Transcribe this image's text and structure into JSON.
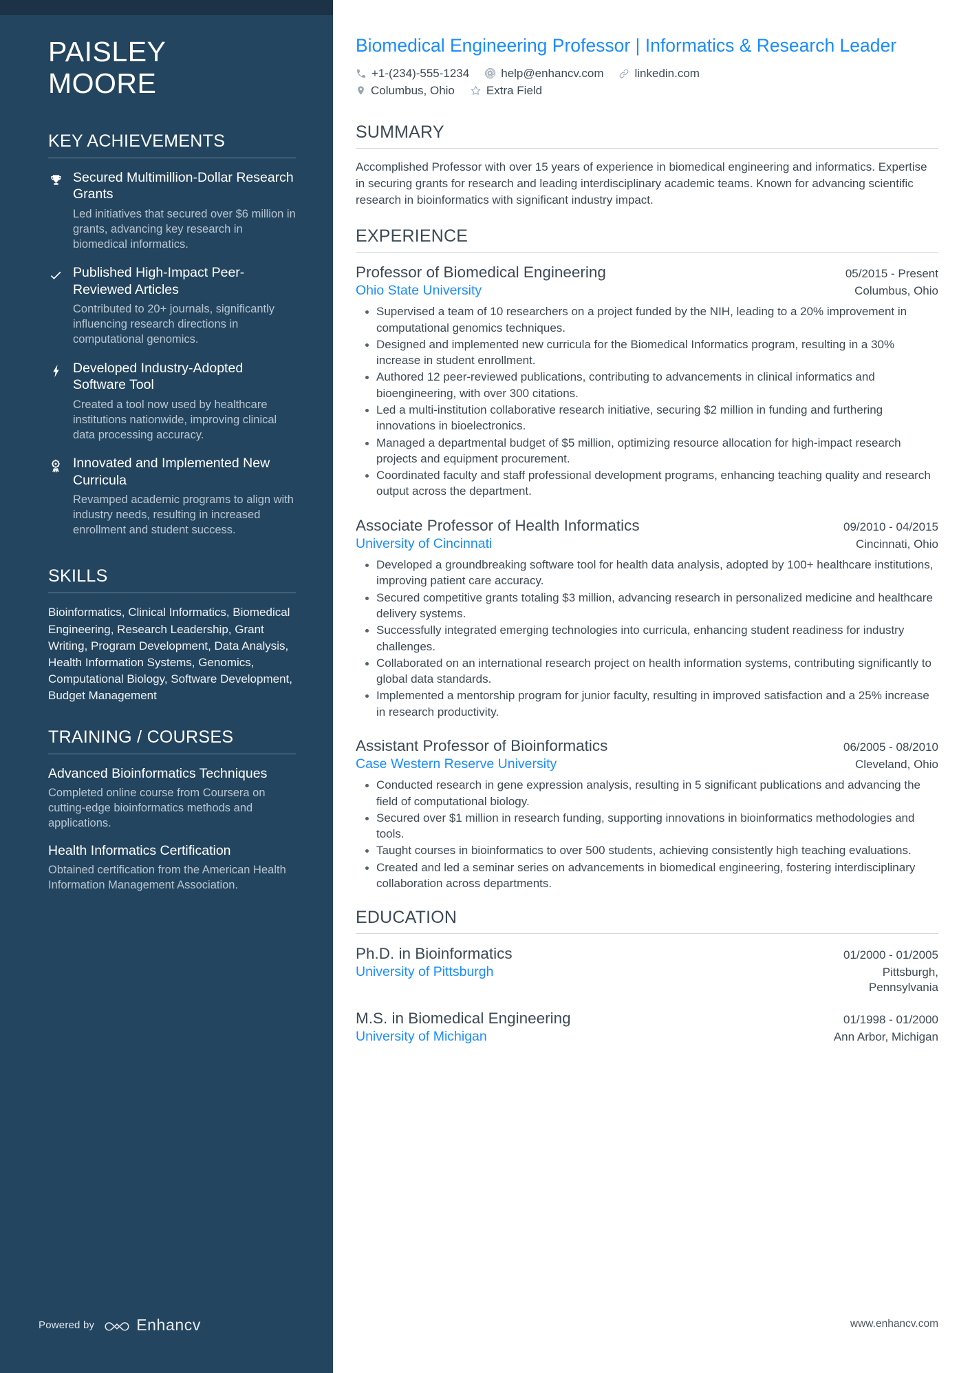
{
  "sidebar": {
    "name_first": "PAISLEY",
    "name_last": "MOORE",
    "key_achievements_heading": "KEY ACHIEVEMENTS",
    "achievements": [
      {
        "icon": "trophy-icon",
        "title": "Secured Multimillion-Dollar Research Grants",
        "desc": "Led initiatives that secured over $6 million in grants, advancing key research in biomedical informatics."
      },
      {
        "icon": "check-icon",
        "title": "Published High-Impact Peer-Reviewed Articles",
        "desc": "Contributed to 20+ journals, significantly influencing research directions in computational genomics."
      },
      {
        "icon": "lightning-bolt-icon",
        "title": "Developed Industry-Adopted Software Tool",
        "desc": "Created a tool now used by healthcare institutions nationwide, improving clinical data processing accuracy."
      },
      {
        "icon": "award-ribbon-icon",
        "title": "Innovated and Implemented New Curricula",
        "desc": "Revamped academic programs to align with industry needs, resulting in increased enrollment and student success."
      }
    ],
    "skills_heading": "SKILLS",
    "skills_text": "Bioinformatics, Clinical Informatics, Biomedical Engineering, Research Leadership, Grant Writing, Program Development, Data Analysis, Health Information Systems, Genomics, Computational Biology, Software Development, Budget Management",
    "training_heading": "TRAINING / COURSES",
    "courses": [
      {
        "title": "Advanced Bioinformatics Techniques",
        "desc": "Completed online course from Coursera on cutting-edge bioinformatics methods and applications."
      },
      {
        "title": "Health Informatics Certification",
        "desc": "Obtained certification from the American Health Information Management Association."
      }
    ],
    "powered_by_label": "Powered by",
    "brand_name": "Enhancv"
  },
  "main": {
    "headline": "Biomedical Engineering Professor | Informatics & Research Leader",
    "contact_row_1": [
      {
        "icon": "phone-icon",
        "text": "+1-(234)-555-1234"
      },
      {
        "icon": "email-at-icon",
        "text": "help@enhancv.com"
      },
      {
        "icon": "link-icon",
        "text": "linkedin.com"
      }
    ],
    "contact_row_2": [
      {
        "icon": "location-pin-icon",
        "text": "Columbus, Ohio"
      },
      {
        "icon": "star-icon",
        "text": "Extra Field"
      }
    ],
    "summary_heading": "SUMMARY",
    "summary_text": "Accomplished Professor with over 15 years of experience in biomedical engineering and informatics. Expertise in securing grants for research and leading interdisciplinary academic teams. Known for advancing scientific research in bioinformatics with significant industry impact.",
    "experience_heading": "EXPERIENCE",
    "experience": [
      {
        "title": "Professor of Biomedical Engineering",
        "date": "05/2015 - Present",
        "org": "Ohio State University",
        "location": "Columbus, Ohio",
        "bullets": [
          "Supervised a team of 10 researchers on a project funded by the NIH, leading to a 20% improvement in computational genomics techniques.",
          "Designed and implemented new curricula for the Biomedical Informatics program, resulting in a 30% increase in student enrollment.",
          "Authored 12 peer-reviewed publications, contributing to advancements in clinical informatics and bioengineering, with over 300 citations.",
          "Led a multi-institution collaborative research initiative, securing $2 million in funding and furthering innovations in bioelectronics.",
          "Managed a departmental budget of $5 million, optimizing resource allocation for high-impact research projects and equipment procurement.",
          "Coordinated faculty and staff professional development programs, enhancing teaching quality and research output across the department."
        ]
      },
      {
        "title": "Associate Professor of Health Informatics",
        "date": "09/2010 - 04/2015",
        "org": "University of Cincinnati",
        "location": "Cincinnati, Ohio",
        "bullets": [
          "Developed a groundbreaking software tool for health data analysis, adopted by 100+ healthcare institutions, improving patient care accuracy.",
          "Secured competitive grants totaling $3 million, advancing research in personalized medicine and healthcare delivery systems.",
          "Successfully integrated emerging technologies into curricula, enhancing student readiness for industry challenges.",
          "Collaborated on an international research project on health information systems, contributing significantly to global data standards.",
          "Implemented a mentorship program for junior faculty, resulting in improved satisfaction and a 25% increase in research productivity."
        ]
      },
      {
        "title": "Assistant Professor of Bioinformatics",
        "date": "06/2005 - 08/2010",
        "org": "Case Western Reserve University",
        "location": "Cleveland, Ohio",
        "bullets": [
          "Conducted research in gene expression analysis, resulting in 5 significant publications and advancing the field of computational biology.",
          "Secured over $1 million in research funding, supporting innovations in bioinformatics methodologies and tools.",
          "Taught courses in bioinformatics to over 500 students, achieving consistently high teaching evaluations.",
          "Created and led a seminar series on advancements in biomedical engineering, fostering interdisciplinary collaboration across departments."
        ]
      }
    ],
    "education_heading": "EDUCATION",
    "education": [
      {
        "title": "Ph.D. in Bioinformatics",
        "date": "01/2000 - 01/2005",
        "org": "University of Pittsburgh",
        "location": "Pittsburgh,\nPennsylvania"
      },
      {
        "title": "M.S. in Biomedical Engineering",
        "date": "01/1998 - 01/2000",
        "org": "University of Michigan",
        "location": "Ann Arbor, Michigan"
      }
    ],
    "site_url": "www.enhancv.com"
  },
  "colors": {
    "sidebar_bg": "#24455f",
    "sidebar_topbar": "#1b3247",
    "accent_blue": "#1a8cff",
    "body_text": "#3d4a55",
    "muted_text": "#b8c6d1"
  }
}
